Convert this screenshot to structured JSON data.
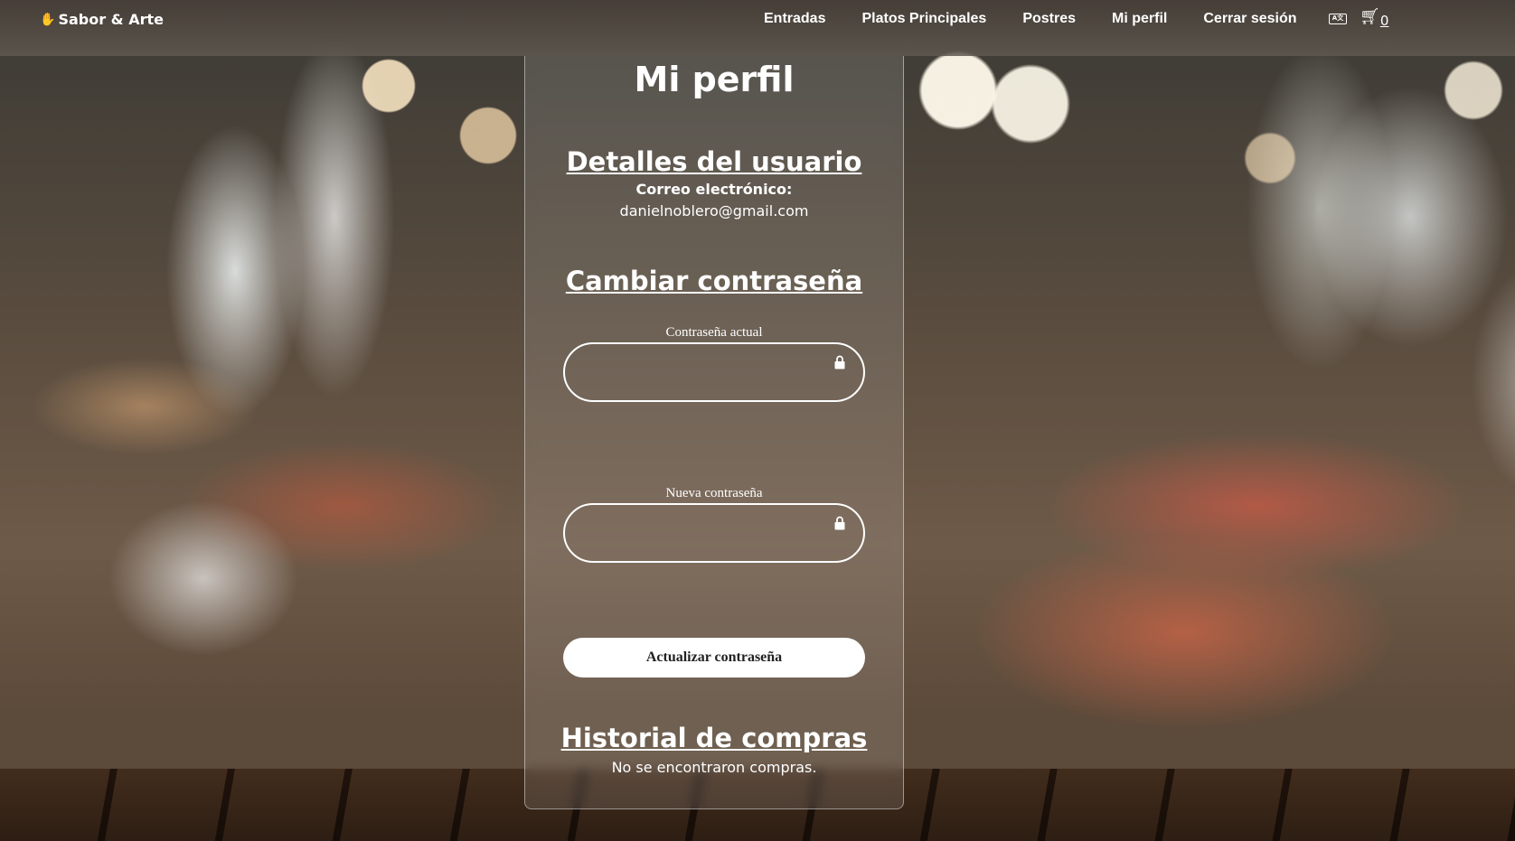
{
  "navbar": {
    "brand": "Sabor & Arte",
    "links": [
      "Entradas",
      "Platos Principales",
      "Postres",
      "Mi perfil",
      "Cerrar sesión"
    ],
    "cart_count": "0"
  },
  "profile": {
    "title": "Mi perfil",
    "details_heading": "Detalles del usuario",
    "email_label": "Correo electrónico:",
    "email_value": "danielnoblero@gmail.com",
    "change_password_heading": "Cambiar contraseña",
    "current_password_label": "Contraseña actual",
    "current_password_value": "",
    "new_password_label": "Nueva contraseña",
    "new_password_value": "",
    "update_button": "Actualizar contraseña",
    "history_heading": "Historial de compras",
    "history_empty": "No se encontraron compras."
  },
  "icons": {
    "brand": "hand-icon",
    "language": "language-icon",
    "cart": "cart-icon",
    "lock": "lock-icon"
  }
}
